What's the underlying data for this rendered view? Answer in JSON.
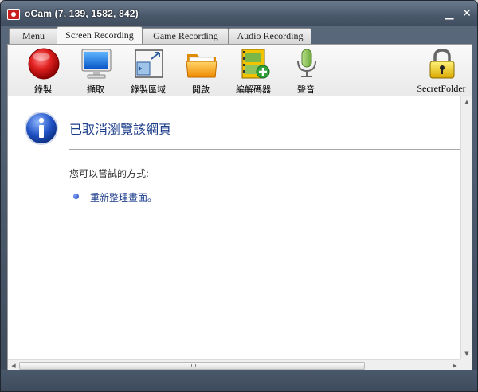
{
  "window": {
    "title": "oCam (7, 139, 1582, 842)",
    "minimize_glyph": "▁",
    "close_glyph": "✕"
  },
  "tabs": [
    {
      "label": "Menu",
      "active": false
    },
    {
      "label": "Screen Recording",
      "active": true
    },
    {
      "label": "Game Recording",
      "active": false
    },
    {
      "label": "Audio Recording",
      "active": false
    }
  ],
  "toolbar": [
    {
      "label": "錄製",
      "icon": "record-icon"
    },
    {
      "label": "擷取",
      "icon": "monitor-capture-icon"
    },
    {
      "label": "錄製區域",
      "icon": "region-select-icon"
    },
    {
      "label": "開啟",
      "icon": "folder-icon"
    },
    {
      "label": "編解碼器",
      "icon": "codec-film-icon"
    },
    {
      "label": "聲音",
      "icon": "microphone-icon"
    },
    {
      "label": "SecretFolder",
      "icon": "padlock-icon"
    }
  ],
  "content": {
    "heading": "已取消瀏覽該網頁",
    "subheading": "您可以嘗試的方式:",
    "bullet_link": "重新整理畫面。"
  },
  "colors": {
    "title_bar": "#4a586b",
    "heading_text": "#1f3f8c",
    "record_red": "#d71a1a",
    "folder_orange": "#f7a21b",
    "padlock_gold": "#e8c21f"
  }
}
